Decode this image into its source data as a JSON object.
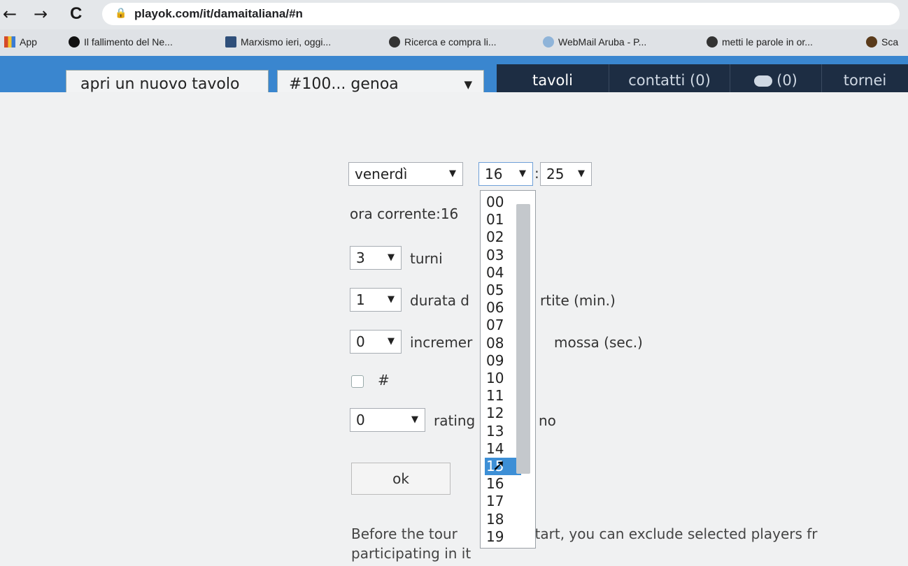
{
  "browser": {
    "back": "←",
    "forward": "→",
    "reload": "C",
    "url": "playok.com/it/damaitaliana/#n",
    "bookmarks": [
      {
        "label": "App",
        "color": "#d54a2a"
      },
      {
        "label": "Il fallimento del Ne...",
        "color": "#111111"
      },
      {
        "label": "Marxismo ieri, oggi...",
        "color": "#2f4f7a"
      },
      {
        "label": "Ricerca e compra li...",
        "color": "#333333"
      },
      {
        "label": "WebMail Aruba - P...",
        "color": "#8fb4d9"
      },
      {
        "label": "metti le parole in or...",
        "color": "#333333"
      },
      {
        "label": "Sca",
        "color": "#5a3b1b"
      }
    ]
  },
  "header": {
    "new_table": "apri un nuovo tavolo",
    "room_select": "#100... genoa",
    "tabs": [
      "tavoli",
      "contatti (0)",
      "(0)",
      "tornei"
    ],
    "active_tab": "tavoli"
  },
  "form": {
    "day": "venerdì",
    "hour": "16",
    "colon": ":",
    "minute": "25",
    "current_time": "ora corrente:16",
    "rounds_value": "3",
    "rounds_label": "turni",
    "duration_value": "1",
    "duration_label_a": "durata d",
    "duration_label_b": "rtite (min.)",
    "increment_value": "0",
    "increment_label_a": "incremer",
    "increment_label_b": "mossa (sec.)",
    "hash_label": "#",
    "rating_value": "0",
    "rating_label_a": "rating",
    "rating_label_b": "no",
    "ok": "ok",
    "note_a": "Before the tour",
    "note_b": "t start, you can exclude selected players fr",
    "note_c": "participating in it"
  },
  "hour_options": [
    "00",
    "01",
    "02",
    "03",
    "04",
    "05",
    "06",
    "07",
    "08",
    "09",
    "10",
    "11",
    "12",
    "13",
    "14",
    "15",
    "16",
    "17",
    "18",
    "19"
  ],
  "highlighted_option": "15",
  "colors": {
    "topbar": "#3a86cf",
    "nav": "#1d2d43",
    "highlight": "#3d8fd6"
  }
}
